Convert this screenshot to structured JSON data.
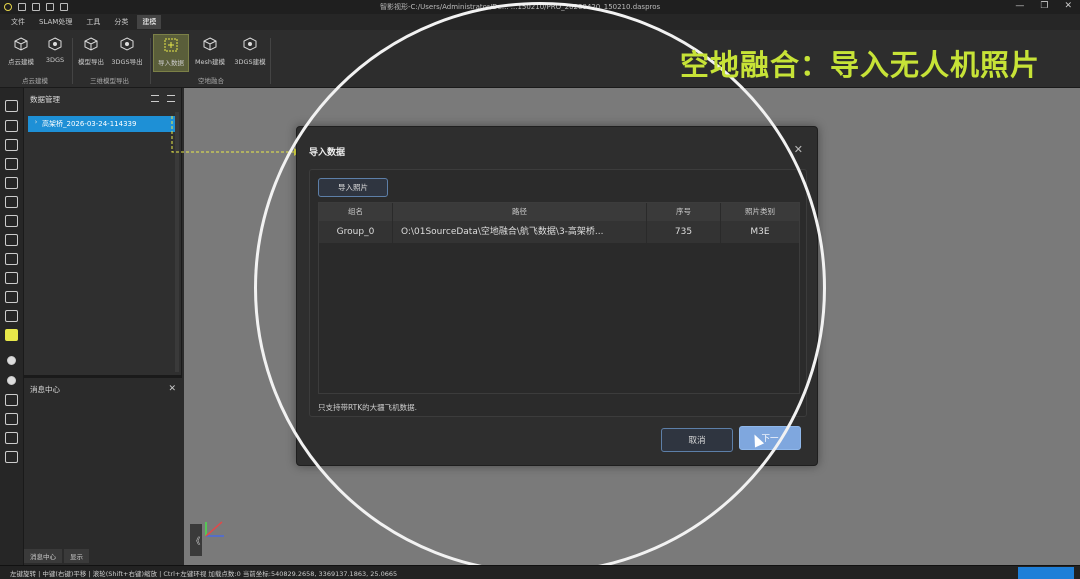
{
  "window": {
    "title": "智影视形-C:/Users/Administrator/De... ...150210/PRO_20260420_150210.daspros",
    "controls": [
      "—",
      "❐",
      "✕"
    ]
  },
  "menu": {
    "items": [
      "文件",
      "SLAM处理",
      "工具",
      "分类",
      "建模"
    ],
    "active_index": 4
  },
  "ribbon": {
    "buttons": [
      "点云建模",
      "3DGS",
      "模型导出",
      "3DGS导出",
      "导入数据",
      "Mesh建模",
      "3DGS建模"
    ],
    "groups": [
      "点云建模",
      "三维模型导出",
      "空地融合"
    ]
  },
  "overlay_title": "空地融合：导入无人机照片",
  "data_panel": {
    "title": "数据管理",
    "tree_item": "高架桥_2026-03-24-114339"
  },
  "message_panel": {
    "title": "消息中心",
    "close": "✕"
  },
  "bottom_tabs": [
    "消息中心",
    "显示"
  ],
  "viewport": {
    "collapse": "《"
  },
  "dialog": {
    "title": "导入数据",
    "close": "✕",
    "import_button": "导入照片",
    "columns": [
      "组名",
      "路径",
      "序号",
      "照片类别"
    ],
    "rows": [
      {
        "group": "Group_0",
        "path": "O:\\01SourceData\\空地融合\\航飞数据\\3-高架桥...",
        "index": "735",
        "category": "M3E"
      }
    ],
    "hint": "只支持带RTK的大疆飞机数据.",
    "cancel": "取消",
    "next": "下一"
  },
  "status": {
    "text": "左键旋转 | 中键(右键)平移 | 滚轮(Shift+右键)缩放 | Ctrl+左键环视    加载点数:0    当前坐标:540829.2658, 3369137.1863, 25.0665"
  },
  "colors": {
    "accent_yellow": "#c7e337",
    "selection_blue": "#1e90d6",
    "next_button": "#7fa7de"
  }
}
